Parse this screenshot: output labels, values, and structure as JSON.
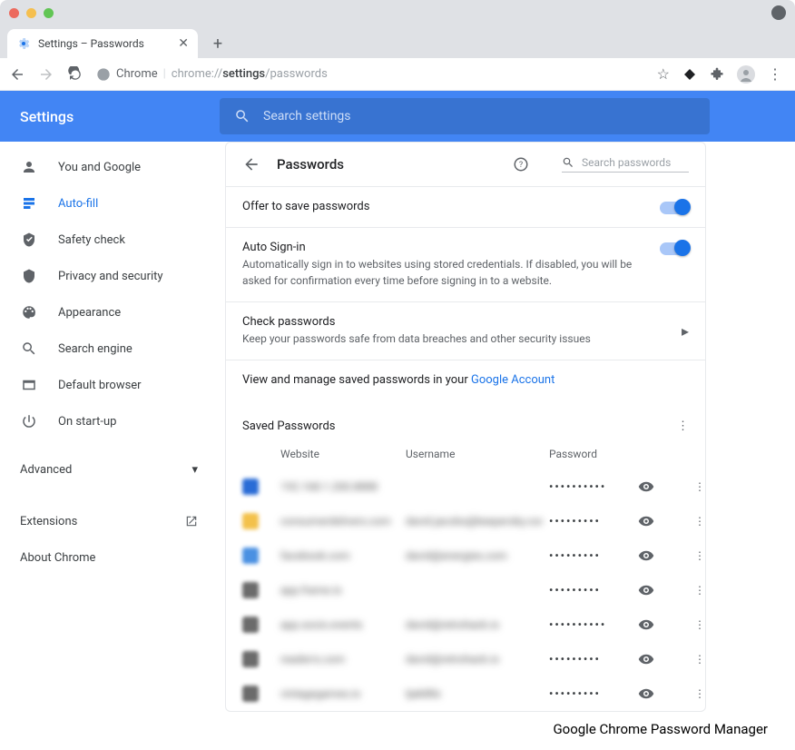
{
  "window": {
    "tab_title": "Settings – Passwords",
    "url_prefix": "Chrome",
    "url_path_thin": "chrome://",
    "url_path_bold": "settings",
    "url_path_tail": "/passwords"
  },
  "header": {
    "title": "Settings",
    "search_placeholder": "Search settings"
  },
  "sidebar": {
    "items": [
      {
        "label": "You and Google",
        "icon": "person"
      },
      {
        "label": "Auto-fill",
        "icon": "autofill",
        "active": true
      },
      {
        "label": "Safety check",
        "icon": "shield-check"
      },
      {
        "label": "Privacy and security",
        "icon": "shield"
      },
      {
        "label": "Appearance",
        "icon": "palette"
      },
      {
        "label": "Search engine",
        "icon": "search"
      },
      {
        "label": "Default browser",
        "icon": "window"
      },
      {
        "label": "On start-up",
        "icon": "power"
      }
    ],
    "advanced": "Advanced",
    "extensions": "Extensions",
    "about": "About Chrome"
  },
  "page": {
    "title": "Passwords",
    "search_passwords_placeholder": "Search passwords",
    "offer_save": "Offer to save passwords",
    "auto_signin_title": "Auto Sign-in",
    "auto_signin_sub": "Automatically sign in to websites using stored credentials. If disabled, you will be asked for confirmation every time before signing in to a website.",
    "check_title": "Check passwords",
    "check_sub": "Keep your passwords safe from data breaches and other security issues",
    "manage_prefix": "View and manage saved passwords in your ",
    "manage_link": "Google Account",
    "saved_header": "Saved Passwords",
    "col_website": "Website",
    "col_username": "Username",
    "col_password": "Password"
  },
  "passwords": [
    {
      "fav": "#2a6cd6",
      "site": "192.168.1.200.8888",
      "user": "",
      "mask": "••••••••••"
    },
    {
      "fav": "#f3c14b",
      "site": "consumerdelivers.com",
      "user": "david.jacobs@keepersky.com",
      "mask": "•••••••••"
    },
    {
      "fav": "#4a90e2",
      "site": "facebook.com",
      "user": "david@energies.com",
      "mask": "•••••••••"
    },
    {
      "fav": "#6b6b6b",
      "site": "app.frame.io",
      "user": "",
      "mask": "•••••••••"
    },
    {
      "fav": "#6b6b6b",
      "site": "app.socio.events",
      "user": "david@retrohack.io",
      "mask": "••••••••••"
    },
    {
      "fav": "#6b6b6b",
      "site": "readerrs.com",
      "user": "david@retrohack.io",
      "mask": "•••••••••"
    },
    {
      "fav": "#6b6b6b",
      "site": "vintagegames.io",
      "user": "tjak88x",
      "mask": "•••••••••"
    }
  ],
  "caption": "Google Chrome Password Manager"
}
